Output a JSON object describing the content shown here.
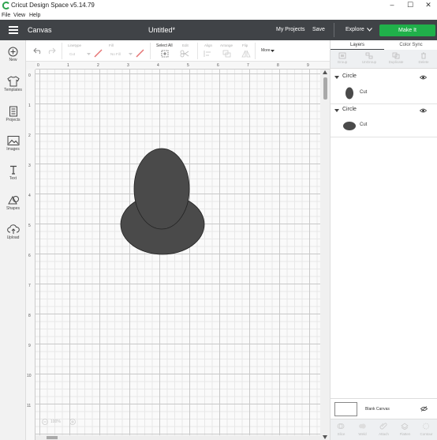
{
  "titlebar": {
    "title": "Cricut Design Space  v5.14.79",
    "minimize": "–",
    "maximize": "☐",
    "close": "✕"
  },
  "menu": {
    "items": [
      "File",
      "View",
      "Help"
    ]
  },
  "header": {
    "section": "Canvas",
    "doc_title": "Untitled*",
    "my_projects": "My Projects",
    "save": "Save",
    "explore": "Explore",
    "make_it": "Make It",
    "accent": "#20b04a",
    "bar_color": "#404347"
  },
  "sidebar": {
    "items": [
      {
        "label": "New",
        "icon": "plus-circle-icon"
      },
      {
        "label": "Templates",
        "icon": "shirt-icon"
      },
      {
        "label": "Projects",
        "icon": "projects-icon"
      },
      {
        "label": "Images",
        "icon": "image-icon"
      },
      {
        "label": "Text",
        "icon": "text-icon"
      },
      {
        "label": "Shapes",
        "icon": "shapes-icon"
      },
      {
        "label": "Upload",
        "icon": "upload-icon"
      }
    ]
  },
  "toolbar": {
    "linetype_label": "Linetype",
    "linetype_value": "Cut",
    "fill_label": "Fill",
    "fill_value": "No Fill",
    "select_all": "Select All",
    "edit": "Edit",
    "align": "Align",
    "arrange": "Arrange",
    "flip": "Flip",
    "more": "More"
  },
  "canvas": {
    "ruler_top": [
      "0",
      "1",
      "2",
      "3",
      "4",
      "5",
      "6",
      "7",
      "8",
      "9"
    ],
    "ruler_left": [
      "0",
      "1",
      "2",
      "3",
      "4",
      "5",
      "6",
      "7",
      "8",
      "9",
      "10",
      "11"
    ],
    "zoom": "100%",
    "shape_color": "#4a4a4a"
  },
  "layers_panel": {
    "tabs": [
      "Layers",
      "Color Sync"
    ],
    "tools": [
      "Group",
      "UnGroup",
      "Duplicate",
      "Delete"
    ],
    "groups": [
      {
        "title": "Circle",
        "item": "Cut"
      },
      {
        "title": "Circle",
        "item": "Cut"
      }
    ],
    "blank_canvas": "Blank Canvas",
    "bottom_tools": [
      "Slice",
      "Weld",
      "Attach",
      "Flatten",
      "Contour"
    ]
  }
}
